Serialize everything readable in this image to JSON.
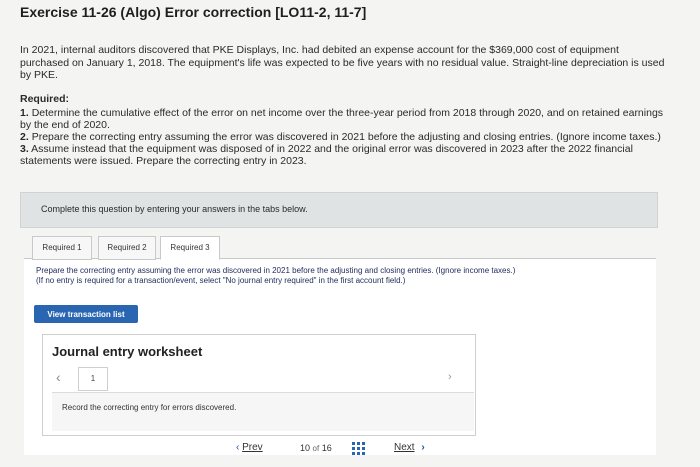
{
  "exercise": {
    "title": "Exercise 11-26 (Algo) Error correction [LO11-2, 11-7]",
    "intro": "In 2021, internal auditors discovered that PKE Displays, Inc. had debited an expense account for the $369,000 cost of equipment purchased on January 1, 2018. The equipment's life was expected to be five years with no residual value. Straight-line depreciation is used by PKE.",
    "required_heading": "Required:",
    "requirements": [
      {
        "num": "1.",
        "text": "Determine the cumulative effect of the error on net income over the three-year period from 2018 through 2020, and on retained earnings by the end of 2020."
      },
      {
        "num": "2.",
        "text": "Prepare the correcting entry assuming the error was discovered in 2021 before the adjusting and closing entries. (Ignore income taxes.)"
      },
      {
        "num": "3.",
        "text": "Assume instead that the equipment was disposed of in 2022 and the original error was discovered in 2023 after the 2022 financial statements were issued. Prepare the correcting entry in 2023."
      }
    ]
  },
  "complete_prompt": "Complete this question by entering your answers in the tabs below.",
  "tabs": [
    {
      "label": "Required 1"
    },
    {
      "label": "Required 2"
    },
    {
      "label": "Required 3"
    }
  ],
  "active_tab": "Required 2",
  "instruction": "Prepare the correcting entry assuming the error was discovered in 2021 before the adjusting and closing entries. (Ignore income taxes.)",
  "instruction_note": "(If no entry is required for a transaction/event, select \"No journal entry required\" in the first account field.)",
  "view_button": "View transaction list",
  "worksheet": {
    "title": "Journal entry worksheet",
    "current_page": "1",
    "record_text": "Record the correcting entry for errors discovered."
  },
  "pager": {
    "prev_label": "Prev",
    "current": "10",
    "of_label": "of",
    "total": "16",
    "next_label": "Next"
  },
  "colors": {
    "link_blue": "#1a4fa0",
    "button_blue": "#2a65b2"
  }
}
